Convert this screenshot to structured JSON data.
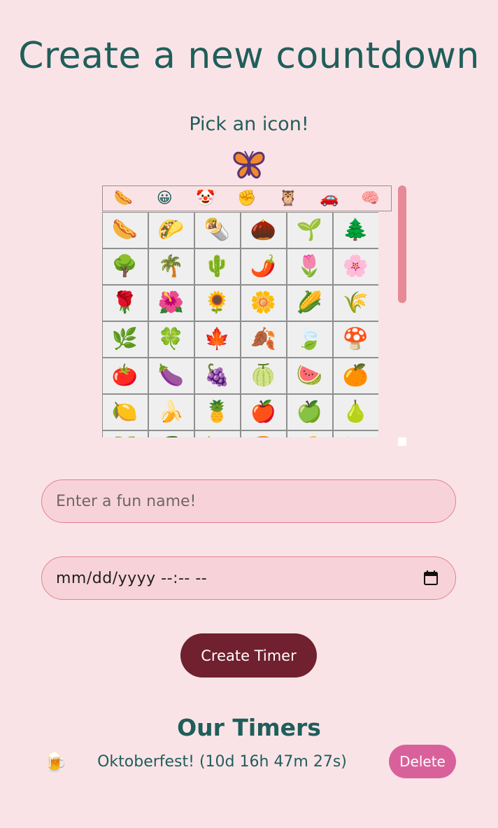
{
  "header": {
    "title": "Create a new countdown"
  },
  "icon_picker": {
    "label": "Pick an icon!",
    "selected_icon": "🦋",
    "categories": [
      "🌭",
      "😀",
      "🤡",
      "✊",
      "🦉",
      "🚗",
      "🧠"
    ],
    "emojis": [
      "🌭",
      "🌮",
      "🌯",
      "🌰",
      "🌱",
      "🌲",
      "🌳",
      "🌴",
      "🌵",
      "🌶️",
      "🌷",
      "🌸",
      "🌹",
      "🌺",
      "🌻",
      "🌼",
      "🌽",
      "🌾",
      "🌿",
      "🍀",
      "🍁",
      "🍂",
      "🍃",
      "🍄",
      "🍅",
      "🍆",
      "🍇",
      "🍈",
      "🍉",
      "🍊",
      "🍋",
      "🍌",
      "🍍",
      "🍎",
      "🍏",
      "🍐",
      "🍑",
      "🍒",
      "🍓",
      "🍔",
      "🍕",
      "🍖"
    ]
  },
  "form": {
    "name_placeholder": "Enter a fun name!",
    "date_placeholder": "mm/dd/yyyy  --:-- --",
    "calendar_icon": "calendar-icon",
    "submit_label": "Create Timer"
  },
  "timers": {
    "heading": "Our Timers",
    "items": [
      {
        "icon": "🍺",
        "text": "Oktoberfest! (10d 16h 47m 27s)",
        "delete_label": "Delete"
      }
    ]
  },
  "colors": {
    "background": "#fae3e6",
    "text": "#1f5e5b",
    "primary_button": "#70202e",
    "delete_button": "#d9619b",
    "input_bg": "#f7d3d9",
    "scroll_thumb": "#e58a96"
  }
}
